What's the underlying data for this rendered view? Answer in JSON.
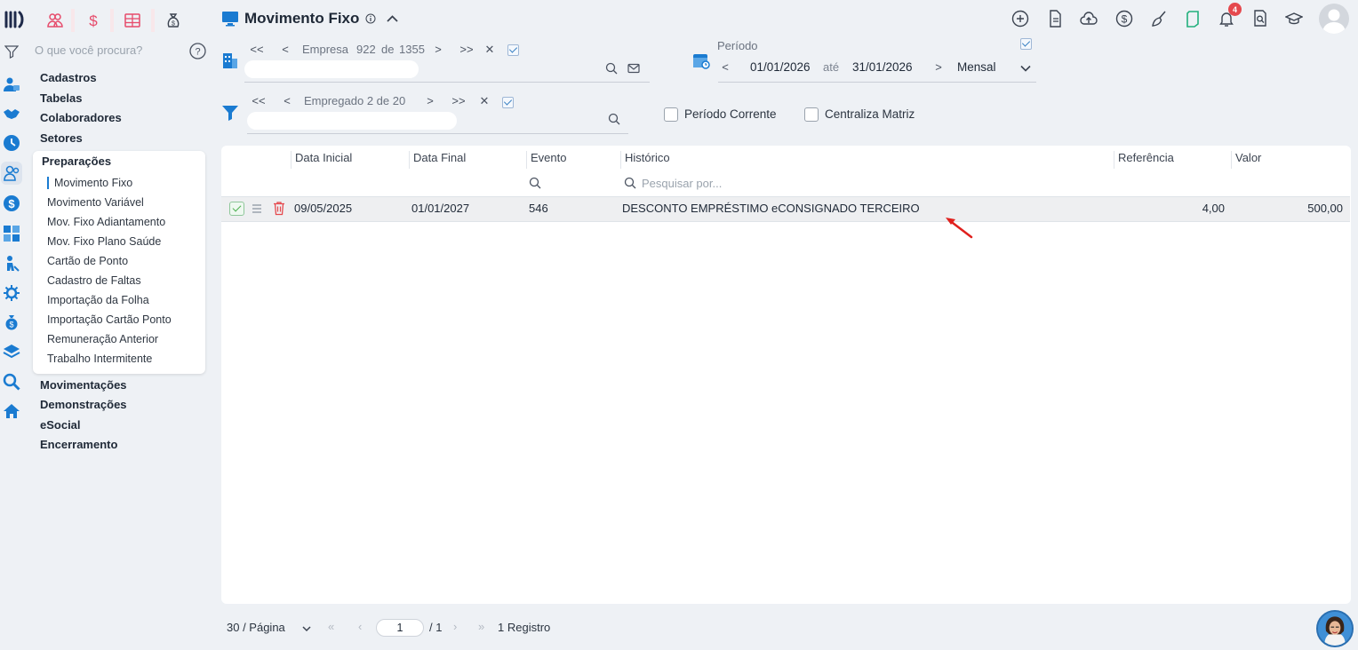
{
  "header": {
    "title": "Movimento Fixo",
    "notifications_count": "4"
  },
  "sidebar": {
    "search_placeholder": "O que você procura?",
    "groups_top": [
      "Cadastros",
      "Tabelas",
      "Colaboradores",
      "Setores"
    ],
    "submenu_title": "Preparações",
    "submenu_items": [
      "Movimento Fixo",
      "Movimento Variável",
      "Mov. Fixo Adiantamento",
      "Mov. Fixo Plano Saúde",
      "Cartão de Ponto",
      "Cadastro de Faltas",
      "Importação da Folha",
      "Importação Cartão Ponto",
      "Remuneração Anterior",
      "Trabalho Intermitente"
    ],
    "groups_bottom": [
      "Movimentações",
      "Demonstrações",
      "eSocial",
      "Encerramento"
    ]
  },
  "company_nav": {
    "first": "<<",
    "prev": "<",
    "label": "Empresa",
    "position": "922",
    "of": "de",
    "total": "1355",
    "next": ">",
    "last": ">>",
    "clear": "✕"
  },
  "employee_nav": {
    "first": "<<",
    "prev": "<",
    "label": "Empregado 2 de 20",
    "next": ">",
    "last": ">>",
    "clear": "✕"
  },
  "period": {
    "label": "Período",
    "prev": "<",
    "start": "01/01/2026",
    "until": "até",
    "end": "31/01/2026",
    "next": ">",
    "mode": "Mensal"
  },
  "options": {
    "periodo_corrente": "Período Corrente",
    "centraliza_matriz": "Centraliza Matriz"
  },
  "table": {
    "columns": [
      "Data Inicial",
      "Data Final",
      "Evento",
      "Histórico",
      "Referência",
      "Valor"
    ],
    "search_placeholder": "Pesquisar por...",
    "rows": [
      {
        "data_inicial": "09/05/2025",
        "data_final": "01/01/2027",
        "evento": "546",
        "historico": "DESCONTO EMPRÉSTIMO eCONSIGNADO TERCEIRO",
        "referencia": "4,00",
        "valor": "500,00"
      }
    ]
  },
  "pagination": {
    "page_size": "30 / Página",
    "first": "«",
    "prev": "‹",
    "page": "1",
    "total_pages": "/ 1",
    "next": "›",
    "last": "»",
    "records": "1 Registro"
  },
  "colors": {
    "accent": "#1a7bd1",
    "danger": "#e5484d",
    "brand_pink": "#e64b6b"
  }
}
